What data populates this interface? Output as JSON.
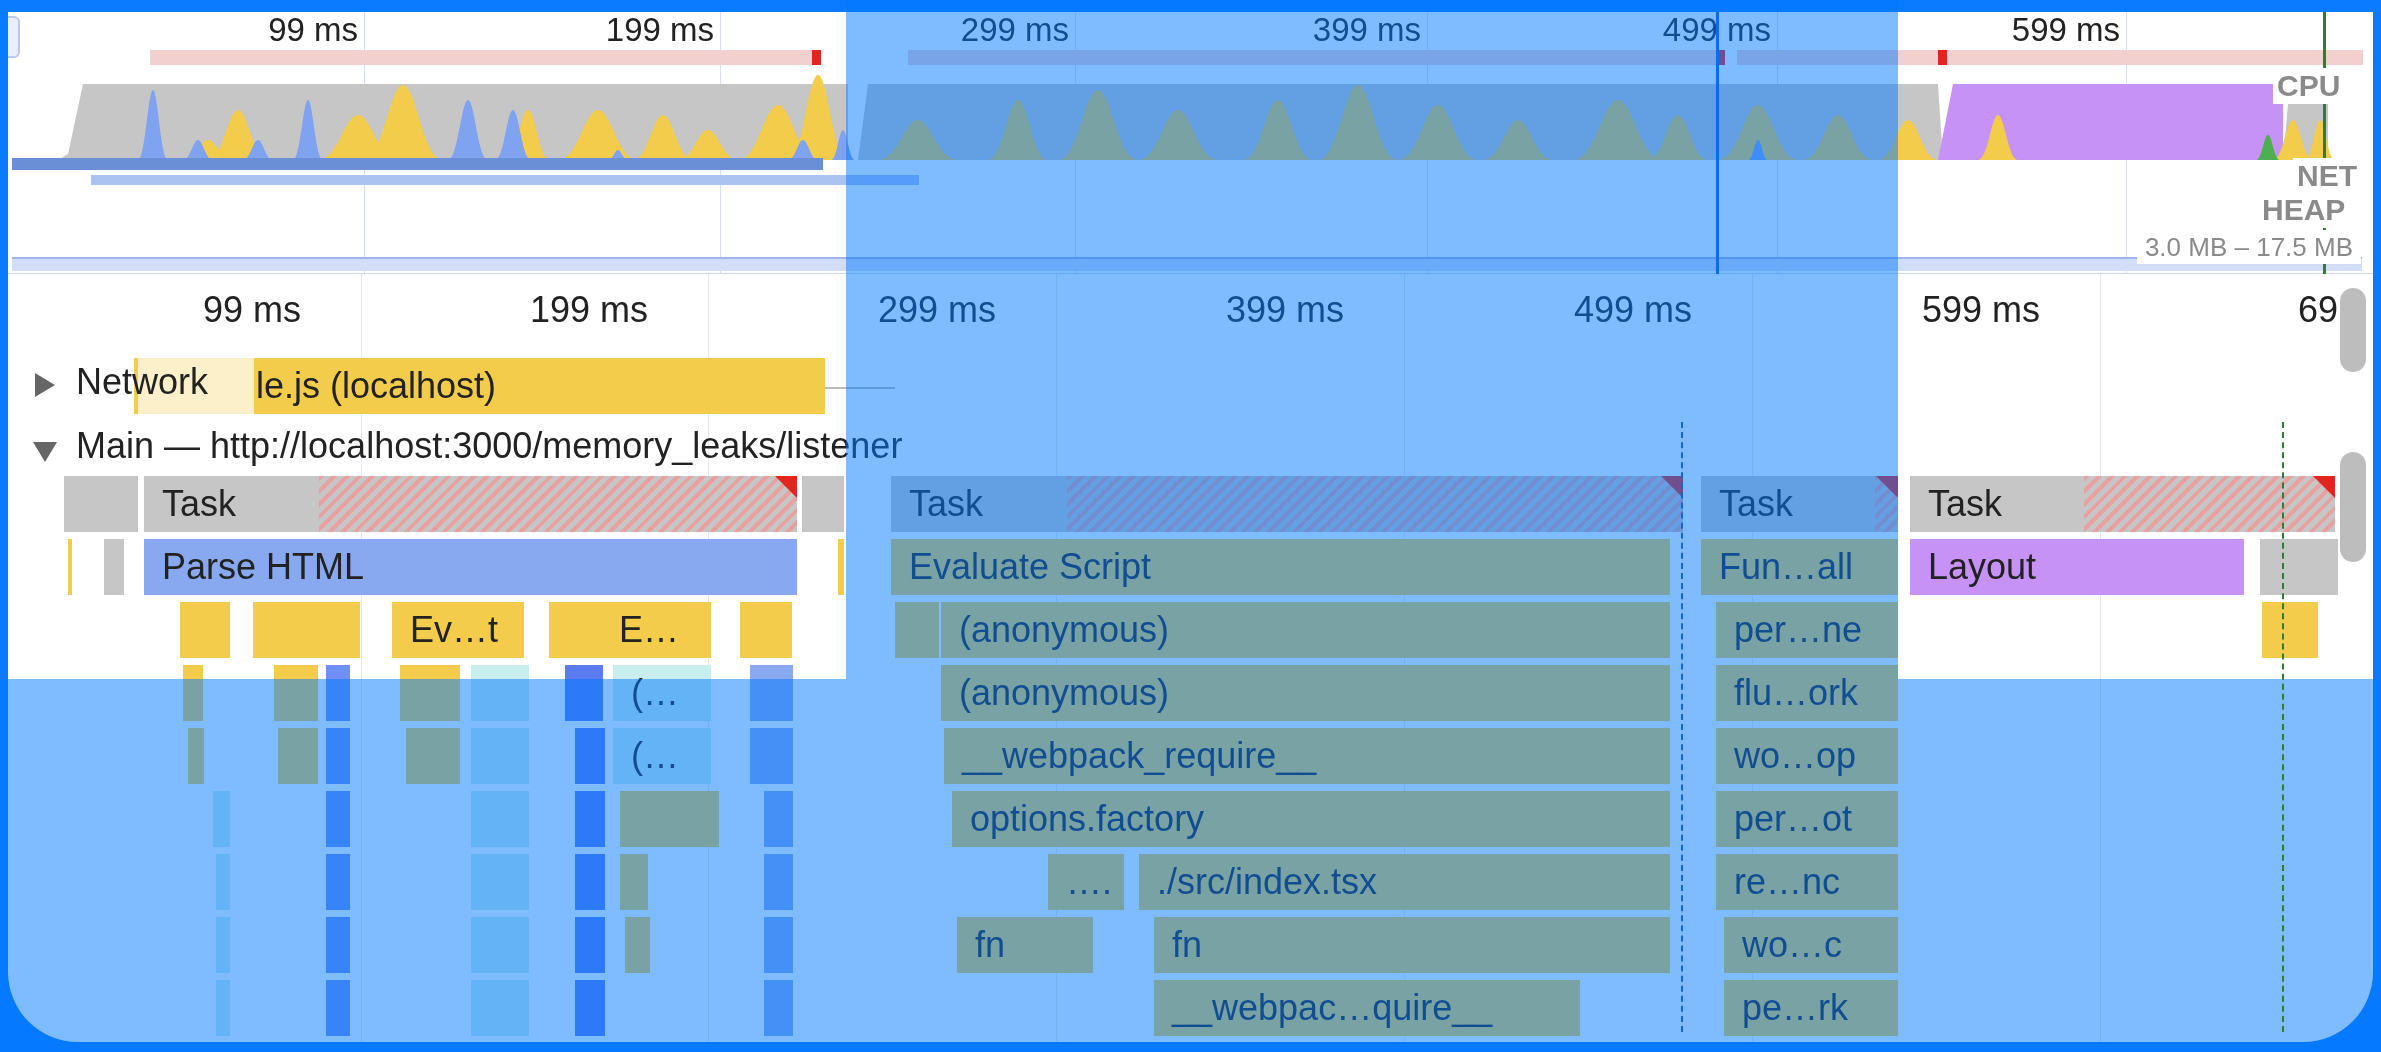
{
  "overview": {
    "ticks": [
      "99 ms",
      "199 ms",
      "299 ms",
      "399 ms",
      "499 ms",
      "599 ms"
    ],
    "track_labels": [
      "CPU",
      "NET",
      "HEAP"
    ],
    "heap_range": "3.0 MB – 17.5 MB"
  },
  "ruler": {
    "ticks": [
      "99 ms",
      "199 ms",
      "299 ms",
      "399 ms",
      "499 ms",
      "599 ms",
      "69"
    ]
  },
  "tracks": [
    {
      "kind": "network",
      "label": "Network",
      "expanded": false,
      "entry": "le.js (localhost)"
    },
    {
      "kind": "main",
      "label": "Main — http://localhost:3000/memory_leaks/listener",
      "expanded": true
    }
  ],
  "flame_rows": [
    [
      {
        "label": "Task",
        "kind": "task",
        "long": true
      },
      {
        "label": "Task",
        "kind": "task",
        "long": true
      },
      {
        "label": "Task",
        "kind": "task",
        "long": true
      },
      {
        "label": "Task",
        "kind": "task",
        "long": true
      }
    ],
    [
      {
        "label": "Parse HTML",
        "kind": "parse"
      },
      {
        "label": "Evaluate Script",
        "kind": "script"
      },
      {
        "label": "Fun…all",
        "kind": "script"
      },
      {
        "label": "Layout",
        "kind": "layout"
      }
    ],
    [
      {
        "label": "Ev…t",
        "kind": "script"
      },
      {
        "label": "E…",
        "kind": "script"
      },
      {
        "label": "(anonymous)",
        "kind": "script"
      },
      {
        "label": "per…ne",
        "kind": "script"
      }
    ],
    [
      {
        "label": "(…",
        "kind": "light"
      },
      {
        "label": "(anonymous)",
        "kind": "script"
      },
      {
        "label": "flu…ork",
        "kind": "script"
      }
    ],
    [
      {
        "label": "(…",
        "kind": "light"
      },
      {
        "label": "__webpack_require__",
        "kind": "script"
      },
      {
        "label": "wo…op",
        "kind": "script"
      }
    ],
    [
      {
        "label": "options.factory",
        "kind": "script"
      },
      {
        "label": "per…ot",
        "kind": "script"
      }
    ],
    [
      {
        "label": "….",
        "kind": "script"
      },
      {
        "label": "./src/index.tsx",
        "kind": "script"
      },
      {
        "label": "re…nc",
        "kind": "script"
      }
    ],
    [
      {
        "label": "fn",
        "kind": "script"
      },
      {
        "label": "fn",
        "kind": "script"
      },
      {
        "label": "wo…c",
        "kind": "script"
      }
    ],
    [
      {
        "label": "__webpac…quire__",
        "kind": "script"
      },
      {
        "label": "pe…rk",
        "kind": "script"
      }
    ]
  ]
}
